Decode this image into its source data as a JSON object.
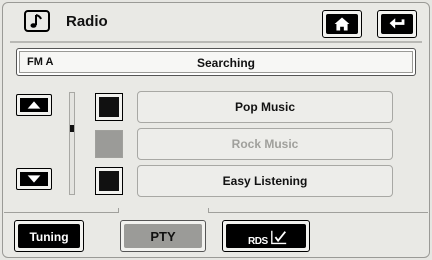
{
  "header": {
    "title": "Radio",
    "home_icon": "home-icon",
    "back_icon": "back-arrow-icon",
    "music_icon": "music-note-icon"
  },
  "status": {
    "band": "FM A",
    "message": "Searching"
  },
  "list": {
    "items": [
      {
        "label": "Pop Music",
        "enabled": true
      },
      {
        "label": "Rock Music",
        "enabled": false
      },
      {
        "label": "Easy Listening",
        "enabled": true
      }
    ]
  },
  "scroll": {
    "up_icon": "triangle-up-icon",
    "down_icon": "triangle-down-icon"
  },
  "tabs": [
    {
      "label": "Tuning",
      "active": false
    },
    {
      "label": "PTY",
      "active": true
    },
    {
      "label": "RDS",
      "active": false,
      "icon": "checkmark-icon"
    }
  ]
}
